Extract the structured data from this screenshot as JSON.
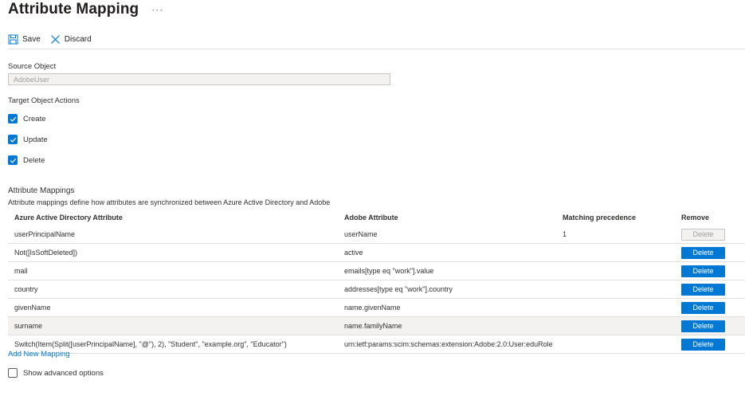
{
  "header": {
    "title": "Attribute Mapping",
    "more": "···"
  },
  "toolbar": {
    "save_label": "Save",
    "discard_label": "Discard"
  },
  "source_object": {
    "label": "Source Object",
    "value": "AdobeUser"
  },
  "target_actions": {
    "label": "Target Object Actions",
    "items": [
      {
        "label": "Create",
        "checked": true
      },
      {
        "label": "Update",
        "checked": true
      },
      {
        "label": "Delete",
        "checked": true
      }
    ]
  },
  "mappings": {
    "title": "Attribute Mappings",
    "description": "Attribute mappings define how attributes are synchronized between Azure Active Directory and Adobe",
    "columns": [
      "Azure Active Directory Attribute",
      "Adobe Attribute",
      "Matching precedence",
      "Remove"
    ],
    "rows": [
      {
        "source": "userPrincipalName",
        "target": "userName",
        "precedence": "1",
        "remove": "Delete",
        "remove_enabled": false
      },
      {
        "source": "Not([IsSoftDeleted])",
        "target": "active",
        "precedence": "",
        "remove": "Delete",
        "remove_enabled": true
      },
      {
        "source": "mail",
        "target": "emails[type eq \"work\"].value",
        "precedence": "",
        "remove": "Delete",
        "remove_enabled": true
      },
      {
        "source": "country",
        "target": "addresses[type eq \"work\"].country",
        "precedence": "",
        "remove": "Delete",
        "remove_enabled": true
      },
      {
        "source": "givenName",
        "target": "name.givenName",
        "precedence": "",
        "remove": "Delete",
        "remove_enabled": true
      },
      {
        "source": "surname",
        "target": "name.familyName",
        "precedence": "",
        "remove": "Delete",
        "remove_enabled": true
      },
      {
        "source": "Switch(Item(Split([userPrincipalName], \"@\"), 2), \"Student\", \"example.org\", \"Educator\")",
        "target": "urn:ietf:params:scim:schemas:extension:Adobe:2.0:User:eduRole",
        "precedence": "",
        "remove": "Delete",
        "remove_enabled": true
      }
    ],
    "add_label": "Add New Mapping"
  },
  "advanced": {
    "label": "Show advanced options",
    "checked": false
  },
  "colors": {
    "accent": "#0078d4",
    "text": "#323130",
    "border": "#e1dfdd",
    "row_shade": "#f3f2f1"
  }
}
